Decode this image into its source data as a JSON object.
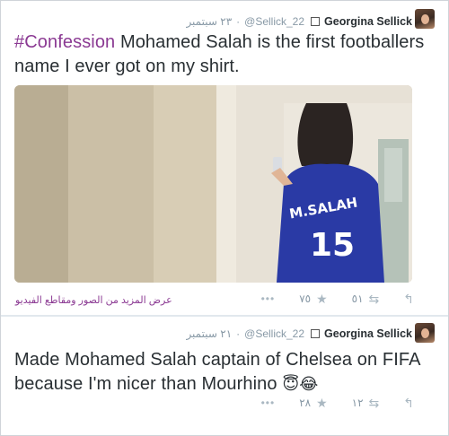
{
  "tweets": [
    {
      "author_name": "Georgina Sellick",
      "handle": "@Sellick_22",
      "date": "٢٣ سبتمبر",
      "text_hashtag": "#Confession",
      "text_body": " Mohamed Salah is the first footballers name I ever got on my shirt.",
      "media_link": "عرض المزيد من الصور ومقاطع الفيديو",
      "favorites": "٧٥",
      "retweets": "٥١",
      "photo": {
        "shirt_name": "M.SALAH",
        "shirt_number": "15"
      }
    },
    {
      "author_name": "Georgina Sellick",
      "handle": "@Sellick_22",
      "date": "٢١ سبتمبر",
      "text_body": "Made Mohamed Salah captain of Chelsea on FIFA because I'm nicer than Mourhino",
      "emoji1": "😇",
      "emoji2": "😂",
      "favorites": "٢٨",
      "retweets": "١٢"
    }
  ],
  "icons": {
    "dot": "·",
    "more": "•••",
    "favorite": "star-icon",
    "retweet": "retweet-icon",
    "reply": "reply-icon"
  },
  "colors": {
    "hashtag": "#8b3a93",
    "name": "#292f33",
    "meta": "#8899a6",
    "icon": "#aab8c2"
  }
}
